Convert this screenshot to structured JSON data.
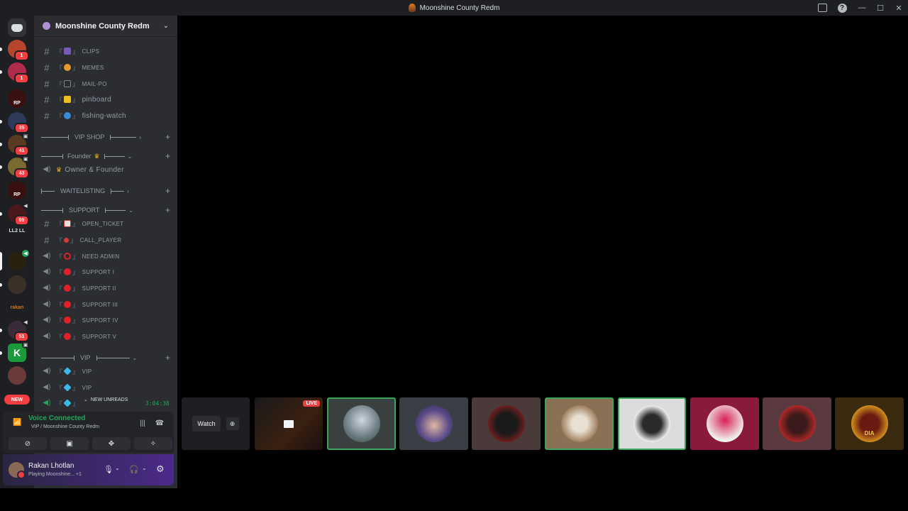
{
  "window": {
    "title": "Moonshine County Redm",
    "minimize": "—",
    "maximize": "☐",
    "close": "✕",
    "help": "?"
  },
  "guilds": {
    "badges": [
      "1",
      "1",
      "35",
      "41",
      "43",
      "69",
      "51"
    ],
    "text_server": "LL2 LL",
    "rp_label": "RP",
    "rakan_label": "rakan",
    "dia_label": "DIA",
    "new_label": "NEW"
  },
  "server": {
    "name": "Moonshine County Redm"
  },
  "channels": [
    {
      "name": "CLIPS"
    },
    {
      "name": "MEMES"
    },
    {
      "name": "MAIL-PO"
    },
    {
      "name": "pinboard"
    },
    {
      "name": "fishing-watch"
    }
  ],
  "categories": {
    "vip_shop": "VIP SHOP",
    "founder": "Founder",
    "waitlisting": "WAITELISTING",
    "support": "SUPPORT",
    "vip": "VIP"
  },
  "founder_channel": "Owner & Founder",
  "support_channels": [
    {
      "name": "OPEN_TICKET"
    },
    {
      "name": "CALL_PLAYER"
    },
    {
      "name": "NEED ADMIN"
    },
    {
      "name": "SUPPORT I"
    },
    {
      "name": "SUPPORT II"
    },
    {
      "name": "SUPPORT III"
    },
    {
      "name": "SUPPORT IV"
    },
    {
      "name": "SUPPORT V"
    }
  ],
  "vip_channels": [
    {
      "name": "VIP"
    },
    {
      "name": "VIP"
    }
  ],
  "new_unreads": "NEW UNREADS",
  "timer": "3:04:38",
  "voice": {
    "status": "Voice Connected",
    "location": "VIP / Moonshine County Redm"
  },
  "user": {
    "name": "Rakan Lhotlan",
    "status": "Playing Moonshine... +1"
  },
  "stage": {
    "watch_label": "Watch",
    "live_label": "LIVE"
  },
  "colors": {
    "accent_green": "#23a55a",
    "live_red": "#ed4245",
    "notification_red": "#f23f43"
  }
}
